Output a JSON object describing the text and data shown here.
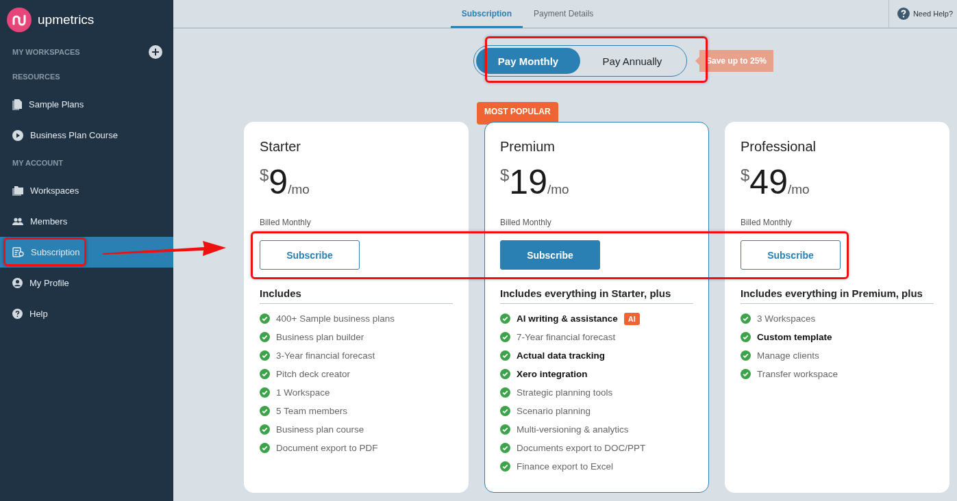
{
  "brand": {
    "name": "upmetrics"
  },
  "sidebar": {
    "sections": [
      {
        "heading": "MY WORKSPACES",
        "addable": true
      },
      {
        "heading": "RESOURCES",
        "addable": false,
        "items": [
          {
            "label": "Sample Plans",
            "selected": false
          },
          {
            "label": "Business Plan Course",
            "selected": false
          }
        ]
      },
      {
        "heading": "MY ACCOUNT",
        "addable": false,
        "items": [
          {
            "label": "Workspaces",
            "selected": false
          },
          {
            "label": "Members",
            "selected": false
          },
          {
            "label": "Subscription",
            "selected": true
          },
          {
            "label": "My Profile",
            "selected": false
          },
          {
            "label": "Help",
            "selected": false
          }
        ]
      }
    ]
  },
  "tabs": [
    {
      "label": "Subscription",
      "selected": true
    },
    {
      "label": "Payment Details",
      "selected": false
    }
  ],
  "help": {
    "label": "Need Help?"
  },
  "billing_toggle": {
    "options": [
      {
        "label": "Pay Monthly",
        "selected": true
      },
      {
        "label": "Pay Annually",
        "selected": false
      }
    ],
    "savings_badge": "Save up to 25%"
  },
  "plans": [
    {
      "name": "Starter",
      "currency": "$",
      "price": "9",
      "period": "/mo",
      "billing": "Billed Monthly",
      "button": "Subscribe",
      "primary": false,
      "featured": false,
      "includes": "Includes",
      "features": [
        {
          "text": "400+ Sample business plans",
          "bold": false
        },
        {
          "text": "Business plan builder",
          "bold": false
        },
        {
          "text": "3-Year financial forecast",
          "bold": false
        },
        {
          "text": "Pitch deck creator",
          "bold": false
        },
        {
          "text": "1 Workspace",
          "bold": false
        },
        {
          "text": "5 Team members",
          "bold": false
        },
        {
          "text": "Business plan course",
          "bold": false
        },
        {
          "text": "Document export to PDF",
          "bold": false
        }
      ]
    },
    {
      "name": "Premium",
      "currency": "$",
      "price": "19",
      "period": "/mo",
      "billing": "Billed Monthly",
      "button": "Subscribe",
      "primary": true,
      "featured": true,
      "ribbon": "MOST POPULAR",
      "includes": "Includes everything in Starter, plus",
      "features": [
        {
          "text": "AI writing & assistance",
          "bold": true,
          "badge": "AI"
        },
        {
          "text": "7-Year financial forecast",
          "bold": false
        },
        {
          "text": "Actual data tracking",
          "bold": true
        },
        {
          "text": "Xero integration",
          "bold": true
        },
        {
          "text": "Strategic planning tools",
          "bold": false
        },
        {
          "text": "Scenario planning",
          "bold": false
        },
        {
          "text": "Multi-versioning & analytics",
          "bold": false
        },
        {
          "text": "Documents export to DOC/PPT",
          "bold": false
        },
        {
          "text": "Finance export to Excel",
          "bold": false
        }
      ]
    },
    {
      "name": "Professional",
      "currency": "$",
      "price": "49",
      "period": "/mo",
      "billing": "Billed Monthly",
      "button": "Subscribe",
      "primary": false,
      "featured": false,
      "includes": "Includes everything in Premium, plus",
      "features": [
        {
          "text": "3 Workspaces",
          "bold": false
        },
        {
          "text": "Custom template",
          "bold": true
        },
        {
          "text": "Manage clients",
          "bold": false
        },
        {
          "text": "Transfer workspace",
          "bold": false
        }
      ]
    }
  ]
}
